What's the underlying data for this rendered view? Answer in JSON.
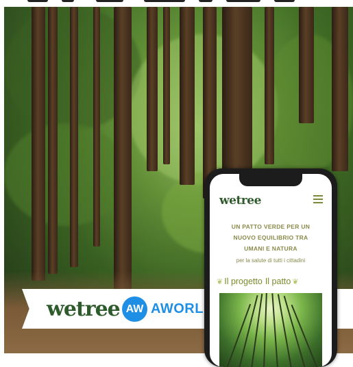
{
  "brand": {
    "wetree_logo": "wetree",
    "partner_badge": "AW",
    "partner_name": "AWORLD"
  },
  "app": {
    "logo": "wetree",
    "tagline_line1": "UN PATTO VERDE PER UN",
    "tagline_line2": "NUOVO EQUILIBRIO TRA",
    "tagline_line3": "UMANI E NATURA",
    "subtagline": "per la salute di tutti i cittadini",
    "tabs": [
      {
        "label": "Il progetto",
        "icon": "leaf-icon"
      },
      {
        "label": "Il patto",
        "icon": "leaf-icon"
      }
    ]
  },
  "colors": {
    "brand_green": "#2e5b2b",
    "aworld_blue": "#1f8fe5",
    "app_olive": "#8a8a4a"
  }
}
